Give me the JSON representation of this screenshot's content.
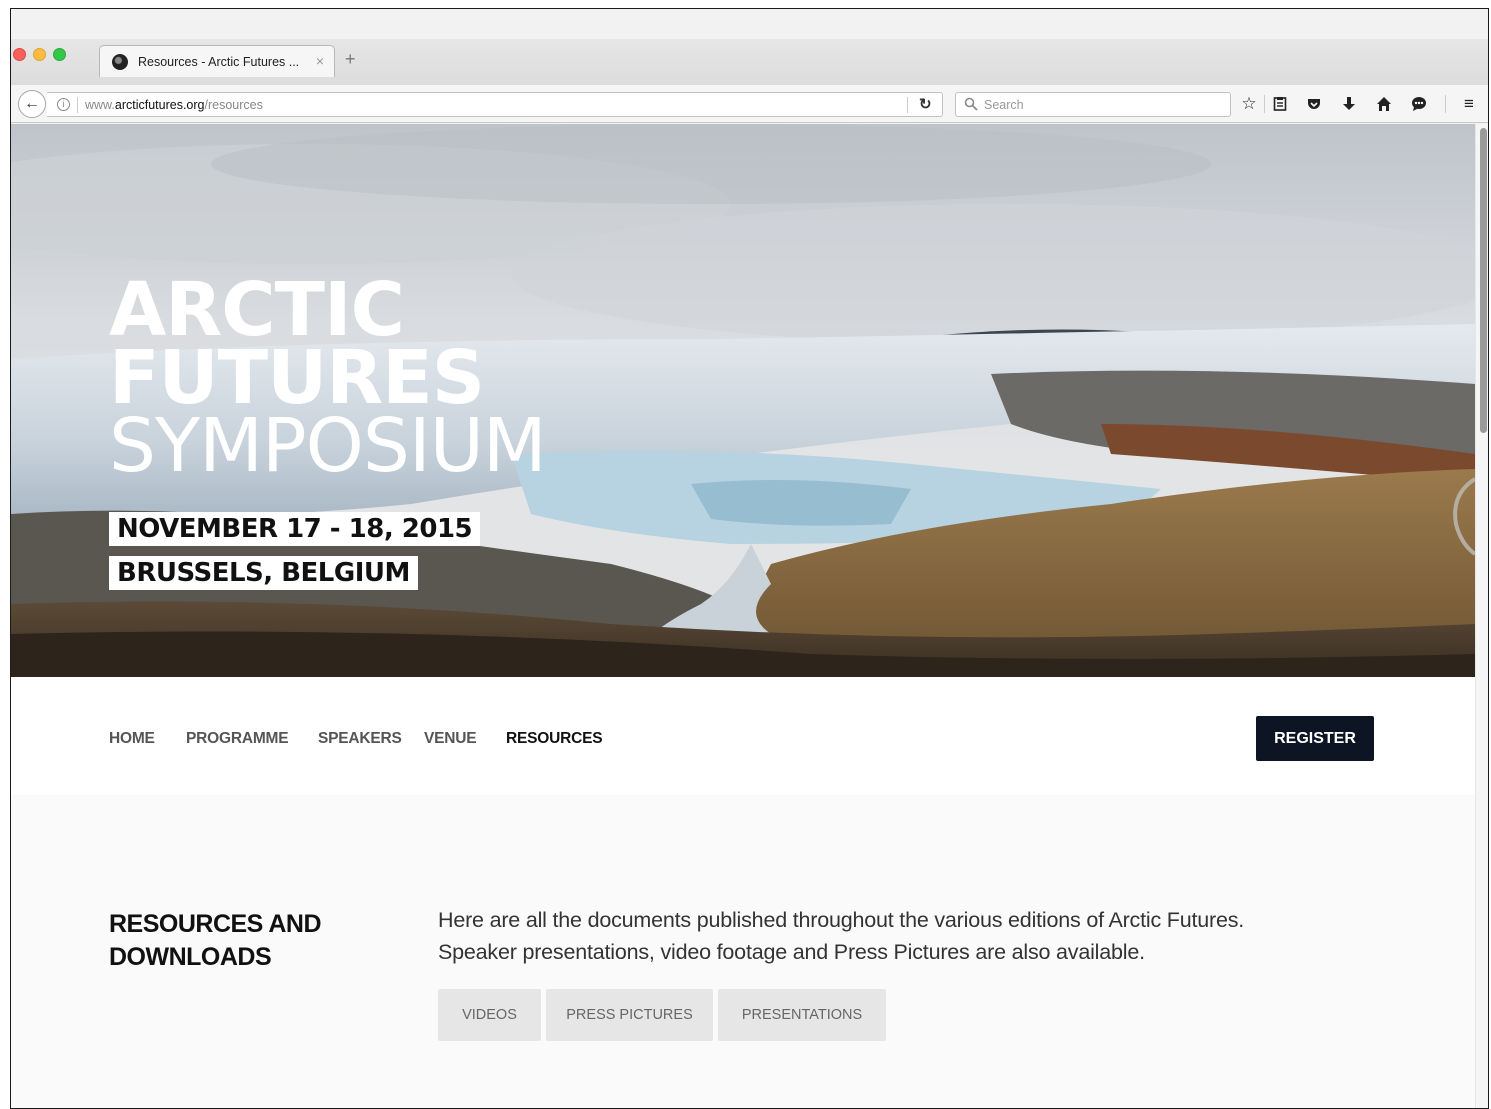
{
  "browser": {
    "tab": {
      "title": "Resources - Arctic Futures ...",
      "close_glyph": "×"
    },
    "new_tab_glyph": "+",
    "url": {
      "prefix": "www.",
      "domain": "arcticfutures.org",
      "path": "/resources"
    },
    "search_placeholder": "Search",
    "toolbar_icons": [
      "star-icon",
      "reading-list-icon",
      "pocket-icon",
      "download-icon",
      "home-icon",
      "chat-icon",
      "menu-icon"
    ]
  },
  "hero": {
    "title_line1": "ARCTIC",
    "title_line2": "FUTURES",
    "title_line3": "SYMPOSIUM",
    "date": "NOVEMBER 17 - 18, 2015",
    "location": "BRUSSELS, BELGIUM"
  },
  "nav": {
    "items": [
      {
        "label": "HOME"
      },
      {
        "label": "PROGRAMME"
      },
      {
        "label": "SPEAKERS"
      },
      {
        "label": "VENUE"
      },
      {
        "label": "RESOURCES",
        "active": true
      }
    ],
    "register_label": "REGISTER"
  },
  "resources": {
    "heading_line1": "RESOURCES AND",
    "heading_line2": "DOWNLOADS",
    "description_line1": "Here are all the documents published throughout the various editions of Arctic Futures.",
    "description_line2": "Speaker presentations, video footage and Press Pictures are also available.",
    "buttons": [
      {
        "label": "VIDEOS"
      },
      {
        "label": "PRESS PICTURES"
      },
      {
        "label": "PRESENTATIONS"
      }
    ]
  },
  "colors": {
    "register_bg": "#0d1424",
    "filter_button_bg": "#e6e6e6",
    "page_bg": "#fafafa"
  }
}
